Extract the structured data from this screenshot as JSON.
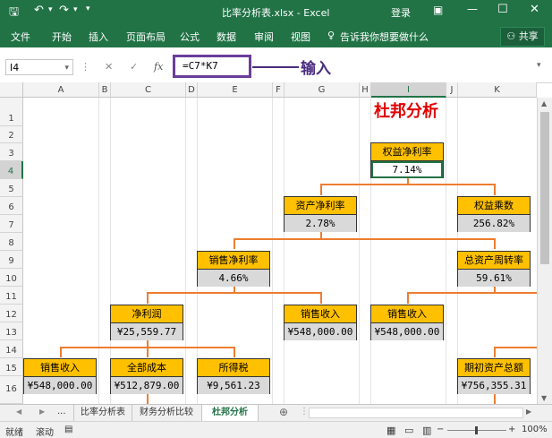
{
  "window": {
    "title": "比率分析表.xlsx - Excel",
    "login_label": "登录"
  },
  "ribbon": {
    "tabs": [
      "文件",
      "开始",
      "插入",
      "页面布局",
      "公式",
      "数据",
      "审阅",
      "视图"
    ],
    "tell_me": "告诉我你想要做什么",
    "share_label": "共享"
  },
  "formula_bar": {
    "name_box": "I4",
    "fx_label": "fx",
    "formula": "=C7*K7",
    "annotation": "输入"
  },
  "grid": {
    "columns": [
      "A",
      "B",
      "C",
      "D",
      "E",
      "F",
      "G",
      "H",
      "I",
      "J",
      "K"
    ],
    "rows": [
      "1",
      "2",
      "3",
      "4",
      "5",
      "6",
      "7",
      "8",
      "9",
      "10",
      "11",
      "12",
      "13",
      "14",
      "15",
      "16"
    ]
  },
  "sheet_title": "杜邦分析",
  "boxes": [
    {
      "label": "权益净利率",
      "value": "7.14%"
    },
    {
      "label": "资产净利率",
      "value": "2.78%"
    },
    {
      "label": "权益乘数",
      "value": "256.82%"
    },
    {
      "label": "销售净利率",
      "value": "4.66%"
    },
    {
      "label": "总资产周转率",
      "value": "59.61%"
    },
    {
      "label": "净利润",
      "value": "¥25,559.77"
    },
    {
      "label": "销售收入",
      "value": "¥548,000.00"
    },
    {
      "label": "销售收入",
      "value": "¥548,000.00"
    },
    {
      "label": "销售收入",
      "value": "¥548,000.00"
    },
    {
      "label": "全部成本",
      "value": "¥512,879.00"
    },
    {
      "label": "所得税",
      "value": "¥9,561.23"
    },
    {
      "label": "期初资产总额",
      "value": "¥756,355.31"
    }
  ],
  "sheet_tabs": {
    "ellipsis": "...",
    "items": [
      "比率分析表",
      "财务分析比较",
      "杜邦分析"
    ],
    "active": 2
  },
  "status": {
    "ready": "就绪",
    "scroll": "滚动",
    "zoom": "100%"
  },
  "colors": {
    "excel_green": "#217346",
    "box_label": "#ffc000",
    "box_value": "#d9d9d9",
    "connector": "#ed7d31",
    "annotation": "#4b2c80",
    "title_red": "#e00000"
  }
}
